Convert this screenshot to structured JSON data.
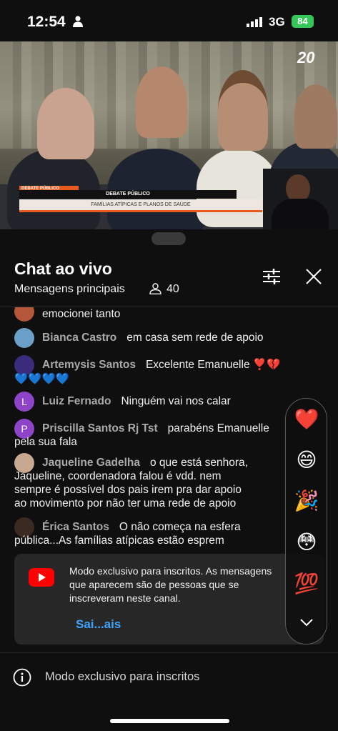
{
  "status_bar": {
    "time": "12:54",
    "network": "3G",
    "battery": "84"
  },
  "video": {
    "channel_logo": "20",
    "lower_third_tag": "DEBATE PÚBLICO",
    "lower_third_title": "DEBATE PÚBLICO",
    "lower_third_subtitle": "FAMÍLIAS ATÍPICAS E PLANOS DE SAÚDE"
  },
  "chat_header": {
    "title": "Chat ao vivo",
    "filter_label": "Mensagens principais",
    "viewer_count": "40"
  },
  "messages": [
    {
      "author": "",
      "text": "emocionei tanto",
      "avatar_color": "#b4563a",
      "avatar_letter": ""
    },
    {
      "author": "Bianca Castro",
      "text": "em casa sem rede de apoio",
      "avatar_color": "#6aa0c7",
      "avatar_letter": ""
    },
    {
      "author": "Artemysis Santos",
      "text": "Excelente Emanuelle ❣️💔",
      "text2": "💙💙💙💙",
      "avatar_color": "#3a2c7a",
      "avatar_letter": ""
    },
    {
      "author": "Luiz Fernado",
      "text": "Ninguém vai nos calar",
      "avatar_color": "#8e44c9",
      "avatar_letter": "L"
    },
    {
      "author": "Priscilla Santos Rj Tst",
      "text": "parabéns Emanuelle",
      "text2": "pela sua fala",
      "avatar_color": "#8e44c9",
      "avatar_letter": "P"
    },
    {
      "author": "Jaqueline Gadelha",
      "text": "o que está senhora,",
      "text2": "Jaqueline, coordenadora falou é vdd. nem",
      "text3": "sempre é possível dos pais irem pra dar apoio",
      "text4": "ao movimento por não ter uma rede de apoio",
      "avatar_color": "#c8a891",
      "avatar_letter": ""
    },
    {
      "author": "Érica Santos",
      "text": "O não começa na esfera",
      "text2": "pública...As famílias atípicas estão esprem",
      "avatar_color": "#3b2a22",
      "avatar_letter": ""
    }
  ],
  "notice": {
    "text": "Modo exclusivo para inscritos. As mensagens que aparecem são de pessoas que se inscreveram neste canal.",
    "link": "Sai...ais"
  },
  "reactions": [
    "❤️",
    "😄",
    "🎉",
    "😳",
    "💯"
  ],
  "footer": {
    "text": "Modo exclusivo para inscritos"
  },
  "icons": {
    "person": "person-icon",
    "signal": "signal-icon",
    "viewers": "viewers-icon",
    "filter": "filter-icon",
    "close": "close-icon",
    "youtube": "youtube-icon",
    "chevron": "chevron-down-icon",
    "info": "info-icon"
  },
  "colors": {
    "background": "#0f0f0f",
    "link": "#3ea6ff",
    "author": "#aaaaaa",
    "battery": "#34c759",
    "youtube_red": "#ff0000"
  }
}
